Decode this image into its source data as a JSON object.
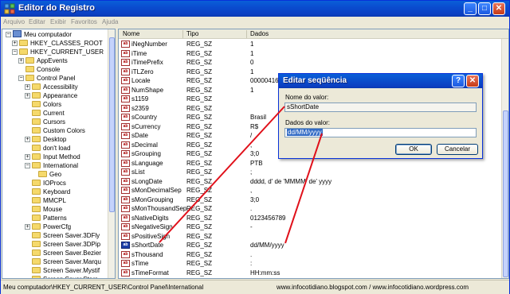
{
  "window": {
    "title": "Editor do Registro",
    "min_glyph": "_",
    "max_glyph": "□",
    "close_glyph": "✕"
  },
  "menu": [
    "Arquivo",
    "Editar",
    "Exibir",
    "Favoritos",
    "Ajuda"
  ],
  "tree": [
    {
      "label": "Meu computador",
      "toggle": "−",
      "icon": "computer"
    },
    {
      "label": "HKEY_CLASSES_ROOT",
      "toggle": "+"
    },
    {
      "label": "HKEY_CURRENT_USER",
      "toggle": "−"
    },
    {
      "label": "AppEvents",
      "toggle": "+"
    },
    {
      "label": "Console",
      "toggle": ""
    },
    {
      "label": "Control Panel",
      "toggle": "−"
    },
    {
      "label": "Accessibility",
      "toggle": "+"
    },
    {
      "label": "Appearance",
      "toggle": "+"
    },
    {
      "label": "Colors",
      "toggle": ""
    },
    {
      "label": "Current",
      "toggle": ""
    },
    {
      "label": "Cursors",
      "toggle": ""
    },
    {
      "label": "Custom Colors",
      "toggle": ""
    },
    {
      "label": "Desktop",
      "toggle": "+"
    },
    {
      "label": "don't load",
      "toggle": ""
    },
    {
      "label": "Input Method",
      "toggle": "+"
    },
    {
      "label": "International",
      "toggle": "−"
    },
    {
      "label": "Geo",
      "toggle": ""
    },
    {
      "label": "IOProcs",
      "toggle": ""
    },
    {
      "label": "Keyboard",
      "toggle": ""
    },
    {
      "label": "MMCPL",
      "toggle": ""
    },
    {
      "label": "Mouse",
      "toggle": ""
    },
    {
      "label": "Patterns",
      "toggle": ""
    },
    {
      "label": "PowerCfg",
      "toggle": "+"
    },
    {
      "label": "Screen Saver.3DFly",
      "toggle": ""
    },
    {
      "label": "Screen Saver.3DPip",
      "toggle": ""
    },
    {
      "label": "Screen Saver.Bezier",
      "toggle": ""
    },
    {
      "label": "Screen Saver.Marqu",
      "toggle": ""
    },
    {
      "label": "Screen Saver.Mystif",
      "toggle": ""
    },
    {
      "label": "Screen Saver.Stars",
      "toggle": ""
    }
  ],
  "columns": {
    "name": "Nome",
    "type": "Tipo",
    "data": "Dados"
  },
  "rows": [
    {
      "name": "iNegNumber",
      "type": "REG_SZ",
      "data": "1"
    },
    {
      "name": "iTime",
      "type": "REG_SZ",
      "data": "1"
    },
    {
      "name": "iTimePrefix",
      "type": "REG_SZ",
      "data": "0"
    },
    {
      "name": "iTLZero",
      "type": "REG_SZ",
      "data": "1"
    },
    {
      "name": "Locale",
      "type": "REG_SZ",
      "data": "00000416"
    },
    {
      "name": "NumShape",
      "type": "REG_SZ",
      "data": "1"
    },
    {
      "name": "s1159",
      "type": "REG_SZ",
      "data": ""
    },
    {
      "name": "s2359",
      "type": "REG_SZ",
      "data": ""
    },
    {
      "name": "sCountry",
      "type": "REG_SZ",
      "data": "Brasil"
    },
    {
      "name": "sCurrency",
      "type": "REG_SZ",
      "data": "R$"
    },
    {
      "name": "sDate",
      "type": "REG_SZ",
      "data": "/"
    },
    {
      "name": "sDecimal",
      "type": "REG_SZ",
      "data": ","
    },
    {
      "name": "sGrouping",
      "type": "REG_SZ",
      "data": "3;0"
    },
    {
      "name": "sLanguage",
      "type": "REG_SZ",
      "data": "PTB"
    },
    {
      "name": "sList",
      "type": "REG_SZ",
      "data": ";"
    },
    {
      "name": "sLongDate",
      "type": "REG_SZ",
      "data": "dddd, d' de 'MMMM' de' yyyy"
    },
    {
      "name": "sMonDecimalSep",
      "type": "REG_SZ",
      "data": ","
    },
    {
      "name": "sMonGrouping",
      "type": "REG_SZ",
      "data": "3;0"
    },
    {
      "name": "sMonThousandSep",
      "type": "REG_SZ",
      "data": "."
    },
    {
      "name": "sNativeDigits",
      "type": "REG_SZ",
      "data": "0123456789"
    },
    {
      "name": "sNegativeSign",
      "type": "REG_SZ",
      "data": "-"
    },
    {
      "name": "sPositiveSign",
      "type": "REG_SZ",
      "data": ""
    },
    {
      "name": "sShortDate",
      "type": "REG_SZ",
      "data": "dd/MM/yyyy"
    },
    {
      "name": "sThousand",
      "type": "REG_SZ",
      "data": "."
    },
    {
      "name": "sTime",
      "type": "REG_SZ",
      "data": ":"
    },
    {
      "name": "sTimeFormat",
      "type": "REG_SZ",
      "data": "HH:mm:ss"
    }
  ],
  "dialog": {
    "title": "Editar seqüência",
    "help_glyph": "?",
    "close_glyph": "✕",
    "name_label": "Nome do valor:",
    "name_value": "sShortDate",
    "data_label": "Dados do valor:",
    "data_value": "dd/MM/yyyy",
    "ok": "OK",
    "cancel": "Cancelar"
  },
  "status": {
    "path": "Meu computador\\HKEY_CURRENT_USER\\Control Panel\\International",
    "website": "www.infocotidiano.blogspot.com / www.infocotidiano.wordpress.com"
  },
  "colors": {
    "annotation": "#e0101a",
    "title_bar": "#0a4ccf",
    "selection": "#316ac5"
  }
}
